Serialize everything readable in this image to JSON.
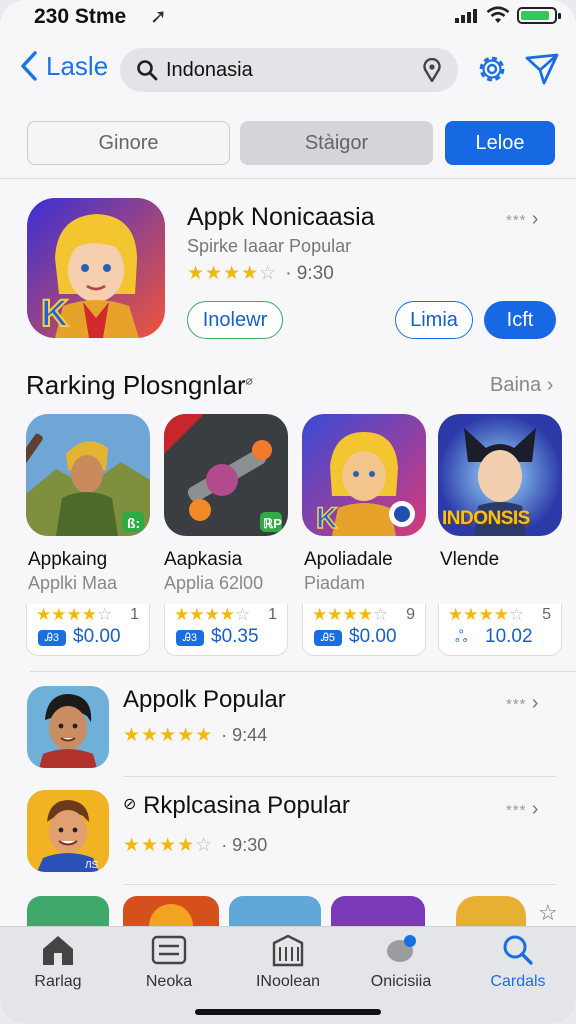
{
  "status_bar": {
    "time": "230 Stme",
    "location_arrow": "location-arrow-icon"
  },
  "nav": {
    "back_label": "Lasle",
    "search_value": "Indonasia"
  },
  "segments": [
    "Ginore",
    "Stàigor",
    "Leloe"
  ],
  "featured": {
    "title": "Appk Nonicaasia",
    "subtitle": "Spirke Iaaar Popular",
    "rating": 4.5,
    "rating_text": "· 9:30",
    "more": "***",
    "buttons": [
      "Inolewr",
      "Limia",
      "Icft"
    ]
  },
  "section": {
    "title": "Rarking Plosngnlar",
    "more_label": "Baina"
  },
  "cards": [
    {
      "name": "Appkaing",
      "sub": "Applki Maa",
      "rating": 4.5,
      "count": "1",
      "badge": "Ꭿ3",
      "price": "$0.00"
    },
    {
      "name": "Aapkasia",
      "sub": "Applia 62l00",
      "rating": 4.5,
      "count": "1",
      "badge": "Ꭿ3",
      "price": "$0.35"
    },
    {
      "name": "Apoliadale",
      "sub": "Piadam",
      "rating": 4.5,
      "count": "9",
      "badge": "Ꭿ5",
      "price": "$0.00"
    },
    {
      "name": "Vlende",
      "sub": "",
      "rating": 4.5,
      "count": "5",
      "badge": "",
      "price": "10.02",
      "icon_text": "INDONSIS"
    }
  ],
  "rows": [
    {
      "title": "Appolk Popular",
      "rating": 5,
      "rating_text": "· 9:44",
      "more": "***"
    },
    {
      "title": "Rkplcasina Popular",
      "rating": 4.5,
      "rating_text": "· 9:30",
      "more": "***"
    }
  ],
  "tabs": [
    {
      "label": "Rarlag",
      "icon": "home-icon"
    },
    {
      "label": "Neoka",
      "icon": "list-icon"
    },
    {
      "label": "INoolean",
      "icon": "building-icon"
    },
    {
      "label": "Onicisiia",
      "icon": "chat-bubble-icon"
    },
    {
      "label": "Cardals",
      "icon": "search-icon",
      "active": true
    }
  ],
  "colors": {
    "accent": "#1668e3",
    "star": "#f2b90c",
    "tab_active": "#1a6fe0"
  }
}
